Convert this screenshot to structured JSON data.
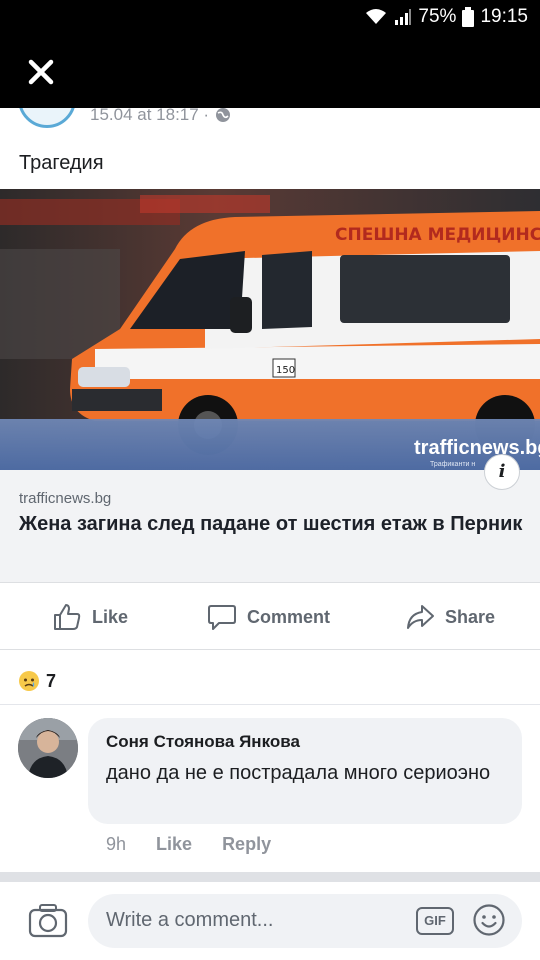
{
  "status_bar": {
    "battery": "75%",
    "time": "19:15"
  },
  "post": {
    "timestamp": "15.04 at 18:17 ·",
    "text": "Трагедия",
    "link": {
      "domain": "trafficnews.bg",
      "title": "Жена загина след падане от шестия етаж в Перник",
      "image": {
        "banner_text": "СПЕШНА МЕДИЦИНСКА П",
        "watermark": "trafficnews.bg",
        "watermark_sub": "Трафиканти н",
        "door_number": "150"
      }
    },
    "actions": {
      "like": "Like",
      "comment": "Comment",
      "share": "Share"
    },
    "reactions": {
      "type": "sad",
      "count": "7"
    }
  },
  "comment": {
    "author": "Соня Стоянова Янкова",
    "text": "дано да не е пострадала много сериоэно",
    "time": "9h",
    "like": "Like",
    "reply": "Reply"
  },
  "composer": {
    "placeholder": "Write a comment...",
    "gif_label": "GIF"
  },
  "colors": {
    "ambulance_orange": "#f0712a",
    "link_bg": "#f2f3f5",
    "meta_gray": "#90949c"
  }
}
